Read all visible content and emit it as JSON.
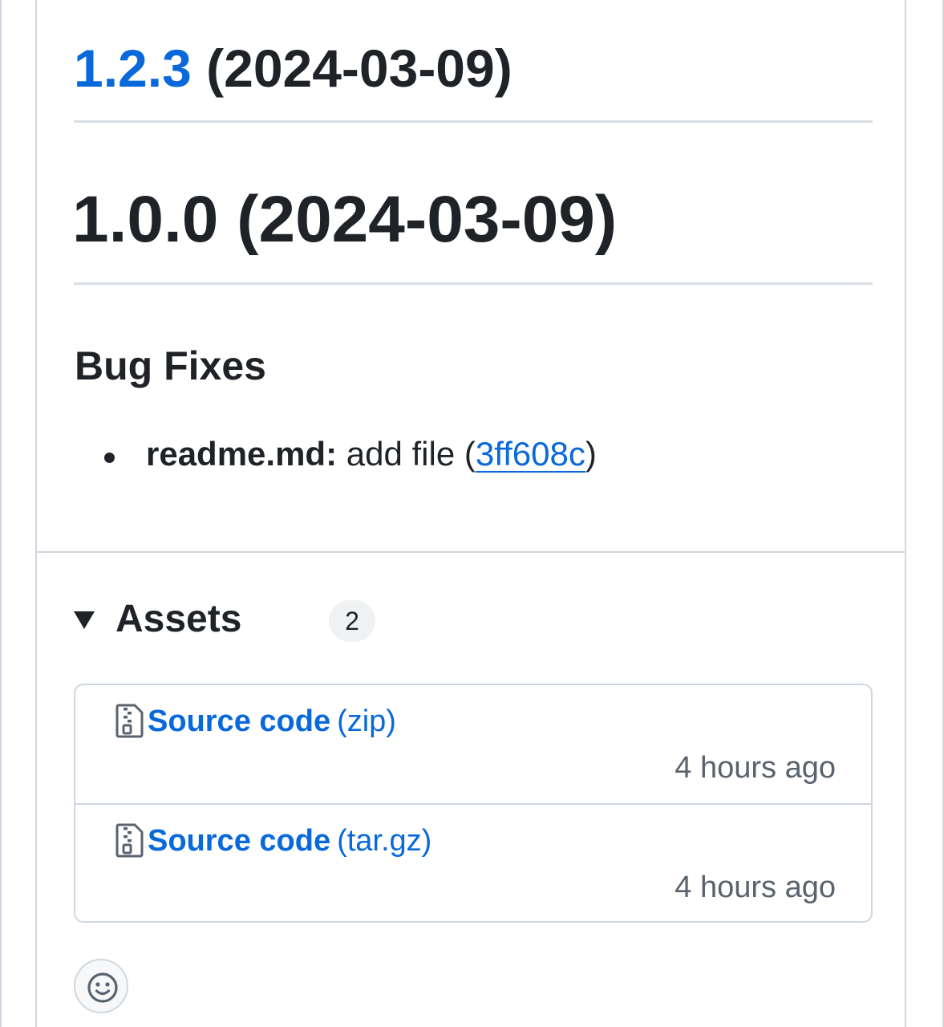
{
  "release_body": {
    "secondary_heading": {
      "version_link": "1.2.3",
      "date": " (2024-03-09)"
    },
    "main_heading": "1.0.0 (2024-03-09)",
    "section_heading": "Bug Fixes",
    "bug_fixes": [
      {
        "scope": "readme.md:",
        "description": " add file (",
        "commit": "3ff608c",
        "close": ")"
      }
    ]
  },
  "assets": {
    "title": "Assets",
    "count": "2",
    "items": [
      {
        "icon": "file-zip-icon",
        "name": "Source code",
        "ext": "(zip)",
        "time": "4 hours ago"
      },
      {
        "icon": "file-zip-icon",
        "name": "Source code",
        "ext": "(tar.gz)",
        "time": "4 hours ago"
      }
    ]
  },
  "reactions": {
    "icon": "smiley-icon"
  },
  "colors": {
    "link": "#0969da",
    "text": "#1f2328",
    "muted": "#59636e",
    "border": "#d0d7de"
  }
}
